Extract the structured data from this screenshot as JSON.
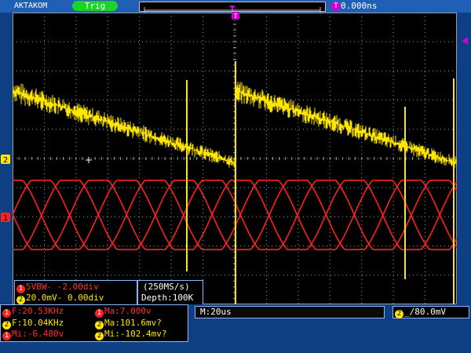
{
  "top": {
    "brand": "AKTAKOM",
    "trigger_status": "Trig",
    "trigger_position_marker": "T",
    "time_offset": "0.000ns"
  },
  "markers": {
    "ch2": "2",
    "ch1": "1"
  },
  "channel_info": {
    "ch1_line": "5VBW- -2.00div",
    "ch2_line": "20.0mV- 0.00div",
    "sample_rate": "(250MS/s)",
    "depth": "Depth:100K",
    "ch1_badge": "1",
    "ch2_badge": "2"
  },
  "measurements": {
    "rows": [
      {
        "badge": "1",
        "channel": "1",
        "text": "F:20.53KHz"
      },
      {
        "badge": "2",
        "channel": "2",
        "text": "F:10.04KHz"
      },
      {
        "badge": "1",
        "channel": "1",
        "text": "Mi:-6.480v"
      }
    ],
    "rows_right": [
      {
        "badge": "1",
        "channel": "1",
        "text": "Ma:7.000v"
      },
      {
        "badge": "2",
        "channel": "2",
        "text": "Ma:101.6mv?"
      },
      {
        "badge": "2",
        "channel": "2",
        "text": "Mi:-102.4mv?"
      }
    ]
  },
  "timebase": {
    "label": "M:20us"
  },
  "trigger": {
    "badge": "2",
    "edge_symbol": "_/",
    "level": "80.0mV"
  },
  "colors": {
    "ch1": "#ff2020",
    "ch2": "#ffe600",
    "grid": "#9a9a9a",
    "background": "#0d3f82"
  }
}
